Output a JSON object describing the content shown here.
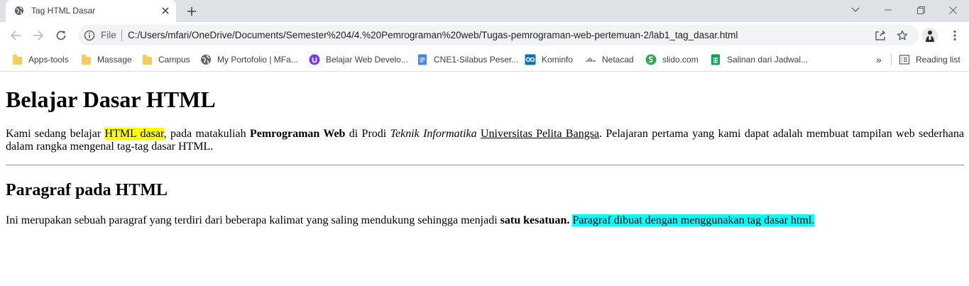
{
  "browser": {
    "tab": {
      "title": "Tag HTML Dasar"
    },
    "address": {
      "scheme": "File",
      "url": "C:/Users/mfari/OneDrive/Documents/Semester%204/4.%20Pemrograman%20web/Tugas-pemrograman-web-pertemuan-2/lab1_tag_dasar.html"
    },
    "bookmarks": [
      {
        "label": "Apps-tools",
        "icon": "folder-icon"
      },
      {
        "label": "Massage",
        "icon": "folder-icon"
      },
      {
        "label": "Campus",
        "icon": "folder-icon"
      },
      {
        "label": "My Portofolio | MFa...",
        "icon": "globe-icon"
      },
      {
        "label": "Belajar Web Develo...",
        "icon": "purple-circle-icon"
      },
      {
        "label": "CNE1-Silabus Peser...",
        "icon": "docs-icon"
      },
      {
        "label": "Kominfo",
        "icon": "kominfo-icon"
      },
      {
        "label": "Netacad",
        "icon": "cisco-icon"
      },
      {
        "label": "slido.com",
        "icon": "slido-icon"
      },
      {
        "label": "Salinan dari Jadwal...",
        "icon": "sheets-icon"
      }
    ],
    "bookmarks_more": "»",
    "reading_list": "Reading list"
  },
  "page": {
    "heading1": "Belajar Dasar HTML",
    "para1": {
      "t1": "Kami sedang belajar ",
      "mark": "HTML dasar",
      "t2": ", pada matakuliah ",
      "bold": "Pemrograman Web",
      "t3": " di Prodi ",
      "italic": "Teknik Informatika",
      "t4": " ",
      "underline": "Universitas Pelita Bangsa",
      "t5": ". Pelajaran pertama yang kami dapat adalah membuat tampilan web sederhana dalam rangka mengenal tag-tag dasar HTML."
    },
    "heading2": "Paragraf pada HTML",
    "para2": {
      "t1": "Ini merupakan sebuah paragraf yang terdiri dari beberapa kalimat yang saling mendukung sehingga menjadi ",
      "bold": "satu kesatuan.",
      "t2": " ",
      "highlight": "Paragraf dibuat dengan menggunakan tag dasar html."
    }
  },
  "colors": {
    "tabstrip": "#dee1e6",
    "omnibox": "#f1f3f4",
    "highlight_yellow": "#ffff00",
    "highlight_cyan": "#00ffff"
  }
}
